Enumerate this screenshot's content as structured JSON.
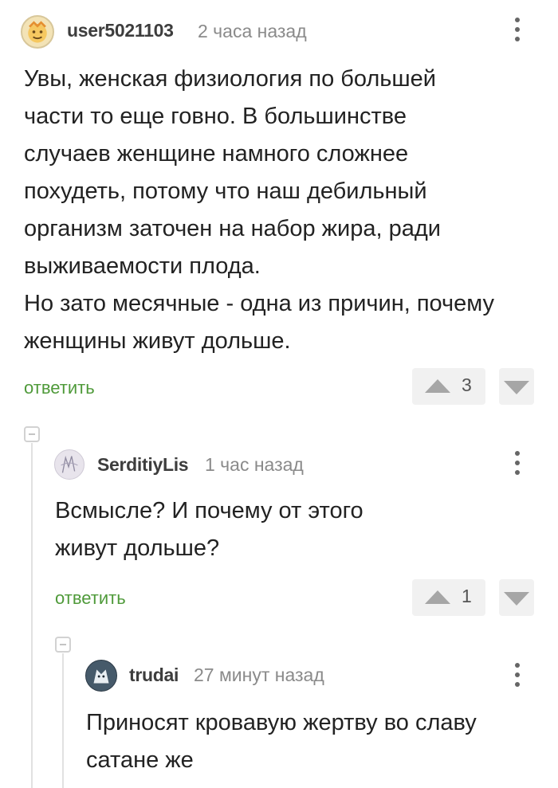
{
  "comments": [
    {
      "username": "user5021103",
      "time": "2 часа назад",
      "text_lines": [
        "Увы, женская физиология по большей",
        "части то еще говно. В большинстве",
        "случаев женщине намного сложнее",
        "похудеть, потому что наш дебильный",
        "организм заточен на набор жира, ради",
        "выживаемости плода.",
        "Но зато месячные - одна из причин, почему",
        "женщины живут дольше."
      ],
      "reply_label": "ответить",
      "rating": "3"
    },
    {
      "username": "SerditiyLis",
      "time": "1 час назад",
      "text_lines": [
        "Всмысле? И почему от этого",
        "живут дольше?"
      ],
      "reply_label": "ответить",
      "rating": "1"
    },
    {
      "username": "trudai",
      "time": "27 минут назад",
      "text_lines": [
        "Приносят кровавую жертву во славу",
        "сатане же"
      ]
    }
  ],
  "icons": {
    "more": "more-vertical-icon",
    "upvote": "upvote-arrow-icon",
    "downvote": "downvote-arrow-icon",
    "collapse": "collapse-thread-icon"
  },
  "colors": {
    "reply": "#4f9a3a",
    "username": "#3d3d3d",
    "meta": "#8a8a8a",
    "vote_bg": "#f1f1f1"
  }
}
